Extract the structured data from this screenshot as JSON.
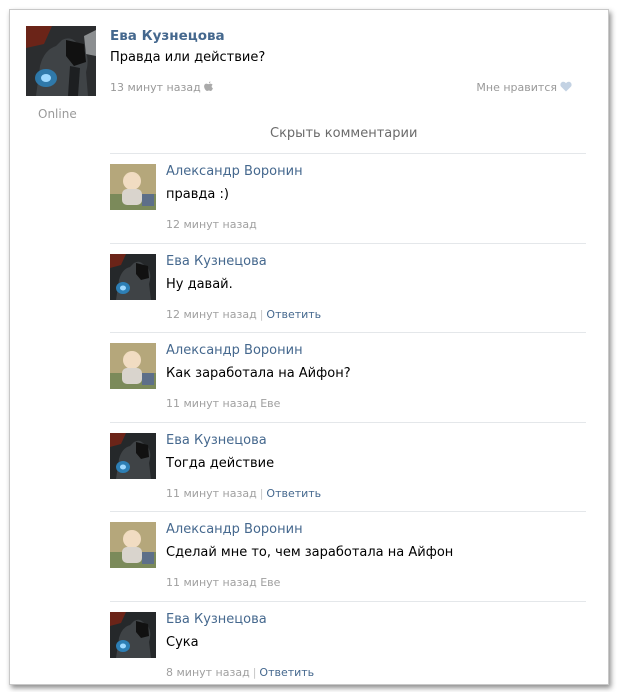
{
  "post": {
    "author": "Ева Кузнецова",
    "text": "Правда или действие?",
    "time": "13 минут назад",
    "status": "Online",
    "like_label": "Мне нравится",
    "icons": {
      "platform": "apple-icon",
      "like": "heart-icon"
    }
  },
  "hide_comments_label": "Скрыть комментарии",
  "comments": [
    {
      "author": "Александр Воронин",
      "text": "правда :)",
      "time": "12 минут назад",
      "suffix": "",
      "reply": "",
      "avatar": "baby"
    },
    {
      "author": "Ева Кузнецова",
      "text": "Ну давай.",
      "time": "12 минут назад",
      "suffix": "",
      "reply": "Ответить",
      "avatar": "dark"
    },
    {
      "author": "Александр Воронин",
      "text": "Как заработала на Айфон?",
      "time": "11 минут назад",
      "suffix": "Еве",
      "reply": "",
      "avatar": "baby"
    },
    {
      "author": "Ева Кузнецова",
      "text": "Тогда действие",
      "time": "11 минут назад",
      "suffix": "",
      "reply": "Ответить",
      "avatar": "dark"
    },
    {
      "author": "Александр Воронин",
      "text": "Сделай мне то, чем заработала на Айфон",
      "time": "11 минут назад",
      "suffix": "Еве",
      "reply": "",
      "avatar": "baby"
    },
    {
      "author": "Ева Кузнецова",
      "text": "Сука",
      "time": "8 минут назад",
      "suffix": "",
      "reply": "Ответить",
      "avatar": "dark"
    }
  ],
  "colors": {
    "link": "#45688e",
    "meta": "#999999",
    "divider": "#e4e7ea"
  }
}
